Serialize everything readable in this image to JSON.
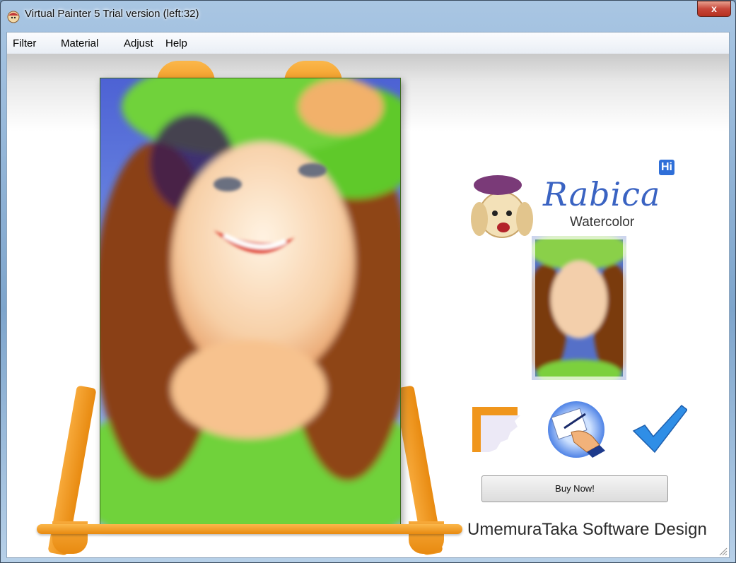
{
  "window": {
    "title": "Virtual Painter 5 Trial version (left:32)",
    "close_symbol": "x"
  },
  "menu": {
    "items": [
      "Filter",
      "Material",
      "Adjust",
      "Help"
    ]
  },
  "brand": {
    "logo_text": "Rabica",
    "subtitle": "Watercolor",
    "badge": "Hi",
    "mascot_icon": "dog-with-beret-icon"
  },
  "tools": [
    {
      "name": "frame-icon",
      "selected": false
    },
    {
      "name": "paint-hand-icon",
      "selected": true
    },
    {
      "name": "checkmark-icon",
      "selected": false
    }
  ],
  "actions": {
    "buy_label": "Buy Now!"
  },
  "footer": {
    "credit": "UmemuraTaka Software Design"
  },
  "colors": {
    "easel": "#f0961c",
    "logo_blue": "#3a63c2",
    "accent_green": "#6fd23a"
  }
}
